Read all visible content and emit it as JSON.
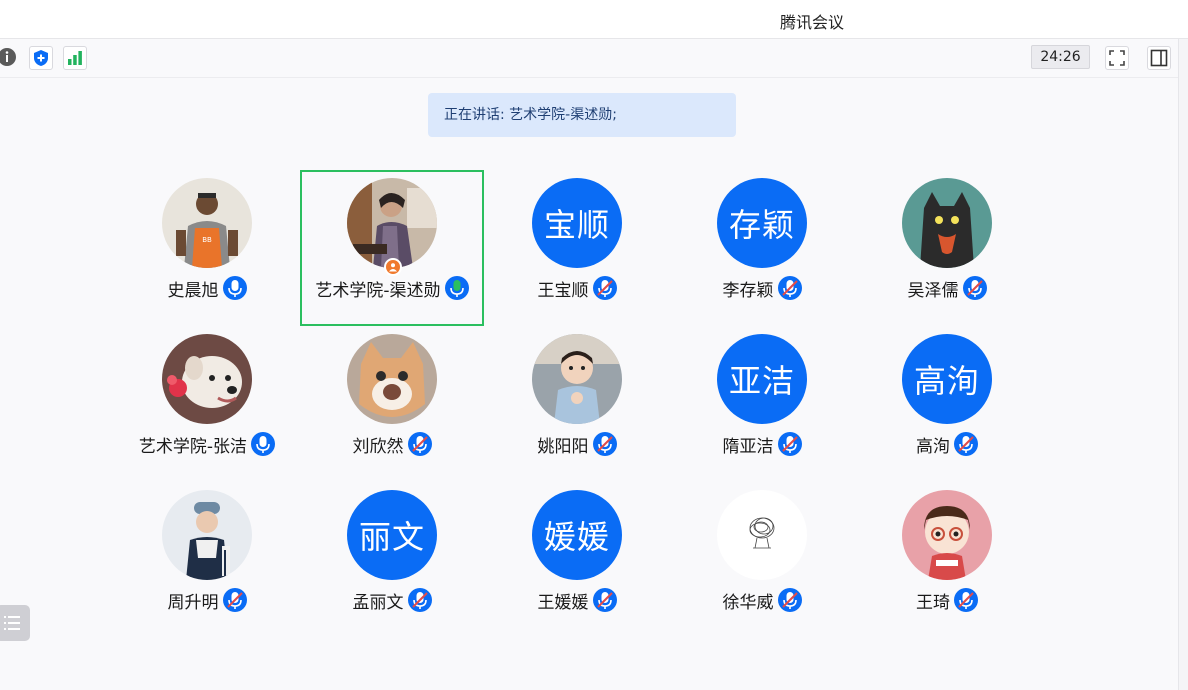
{
  "window": {
    "title": "腾讯会议"
  },
  "toolbar": {
    "timer": "24:26"
  },
  "banner": {
    "speaking": "正在讲话: 艺术学院-渠述勋;"
  },
  "colors": {
    "accent": "#0a6cf5",
    "active_border": "#2bbf5f",
    "speaking_mic": "#2bbf5f"
  },
  "participants": [
    {
      "name": "史晨旭",
      "avatar": "photo",
      "mic": "on"
    },
    {
      "name": "艺术学院-渠述勋",
      "avatar": "photo",
      "mic": "speaking",
      "host": true,
      "active": true
    },
    {
      "name": "王宝顺",
      "avatar": "text",
      "avatar_text": "宝顺",
      "mic": "muted"
    },
    {
      "name": "李存颖",
      "avatar": "text",
      "avatar_text": "存颖",
      "mic": "muted"
    },
    {
      "name": "吴泽儒",
      "avatar": "photo",
      "mic": "muted"
    },
    {
      "name": "艺术学院-张洁",
      "avatar": "photo",
      "mic": "on"
    },
    {
      "name": "刘欣然",
      "avatar": "photo",
      "mic": "muted"
    },
    {
      "name": "姚阳阳",
      "avatar": "photo",
      "mic": "muted"
    },
    {
      "name": "隋亚洁",
      "avatar": "text",
      "avatar_text": "亚洁",
      "mic": "muted"
    },
    {
      "name": "高洵",
      "avatar": "text",
      "avatar_text": "高洵",
      "mic": "muted"
    },
    {
      "name": "周升明",
      "avatar": "photo",
      "mic": "muted"
    },
    {
      "name": "孟丽文",
      "avatar": "text",
      "avatar_text": "丽文",
      "mic": "muted"
    },
    {
      "name": "王媛媛",
      "avatar": "text",
      "avatar_text": "媛媛",
      "mic": "muted"
    },
    {
      "name": "徐华威",
      "avatar": "photo",
      "mic": "muted"
    },
    {
      "name": "王琦",
      "avatar": "photo",
      "mic": "muted"
    }
  ]
}
